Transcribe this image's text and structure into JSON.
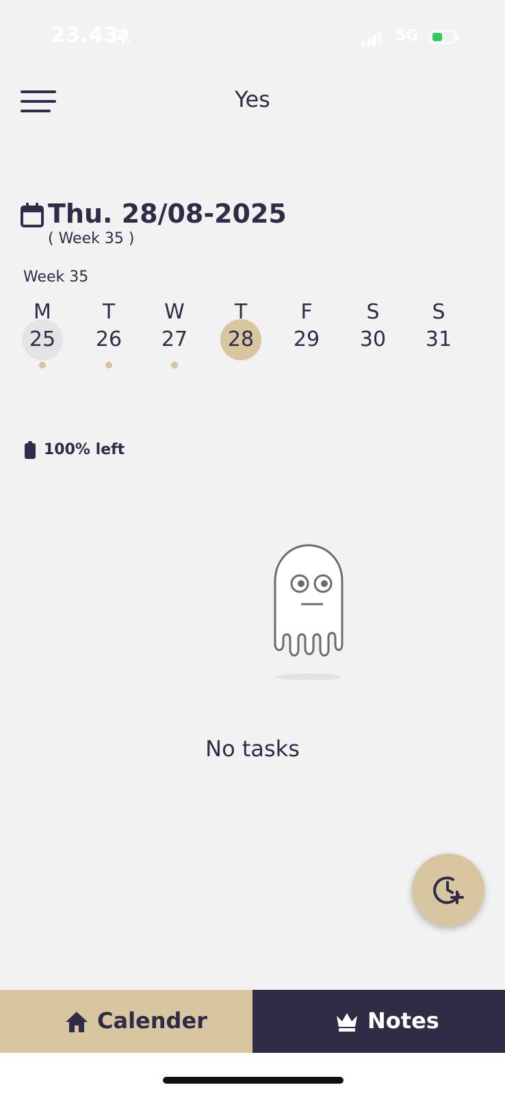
{
  "status_bar": {
    "time": "23.43",
    "network": "5G",
    "icons": [
      "bell-off-icon",
      "signal-icon",
      "battery-charging-icon"
    ]
  },
  "header": {
    "title": "Yes",
    "menu_icon": "hamburger-menu-icon"
  },
  "date_header": {
    "icon": "calendar-icon",
    "date": "Thu. 28/08-2025",
    "week": "( Week 35 )"
  },
  "week_strip": {
    "label": "Week 35",
    "days": [
      {
        "letter": "M",
        "number": "25",
        "state": "today-outline",
        "has_dot": true
      },
      {
        "letter": "T",
        "number": "26",
        "state": "normal",
        "has_dot": true
      },
      {
        "letter": "W",
        "number": "27",
        "state": "normal",
        "has_dot": true
      },
      {
        "letter": "T",
        "number": "28",
        "state": "selected",
        "has_dot": false
      },
      {
        "letter": "F",
        "number": "29",
        "state": "normal",
        "has_dot": false
      },
      {
        "letter": "S",
        "number": "30",
        "state": "normal",
        "has_dot": false
      },
      {
        "letter": "S",
        "number": "31",
        "state": "normal",
        "has_dot": false
      }
    ]
  },
  "energy": {
    "icon": "battery-full-icon",
    "text": "100% left",
    "level_percent": 100
  },
  "empty_state": {
    "illustration": "ghost-icon",
    "text": "No tasks"
  },
  "fab": {
    "icon": "clock-plus-icon"
  },
  "bottom_nav": {
    "calendar": {
      "label": "Calender",
      "icon": "home-icon"
    },
    "notes": {
      "label": "Notes",
      "icon": "crown-icon"
    }
  },
  "colors": {
    "background": "#f2f2f2",
    "primary_dark": "#2f2c47",
    "accent_gold": "#d8c6a1",
    "dot": "#d6c3a0",
    "today_circle": "#e4e4e4"
  }
}
